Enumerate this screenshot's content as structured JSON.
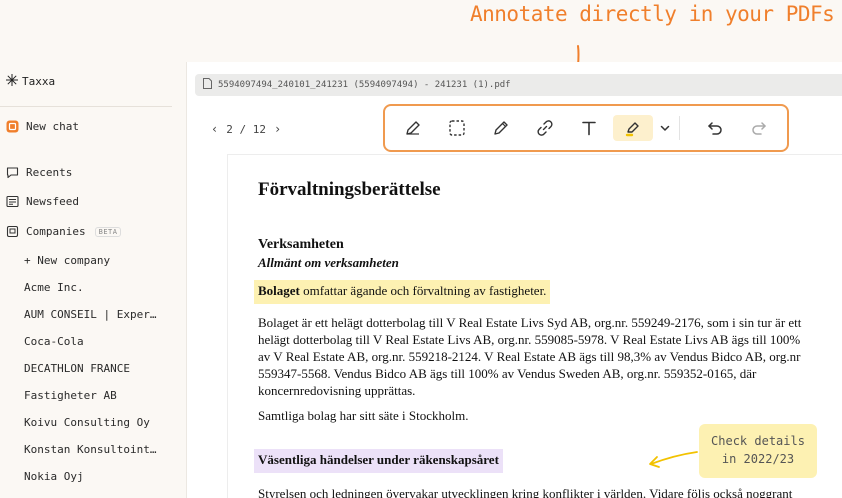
{
  "headline": "Annotate directly in your PDFs",
  "sidebar": {
    "brand": "Taxxa",
    "new_chat": "New chat",
    "recents": "Recents",
    "newsfeed": "Newsfeed",
    "companies": "Companies",
    "beta": "BETA",
    "new_company": "+ New company",
    "company_list": [
      "Acme Inc.",
      "AUM CONSEIL | Exper…",
      "Coca-Cola",
      "DECATHLON FRANCE",
      "Fastigheter AB",
      "Koivu Consulting Oy",
      "Konstan Konsultoint…",
      "Nokia Oyj"
    ]
  },
  "viewer": {
    "file_name": "5594097494_240101_241231 (5594097494) - 241231 (1).pdf",
    "page_indicator": "2 / 12"
  },
  "toolbar": {
    "tools": [
      "pen-icon",
      "select-area-icon",
      "pencil-icon",
      "link-icon",
      "text-icon",
      "highlighter-icon"
    ],
    "accent": "#f09a4f"
  },
  "document": {
    "title": "Förvaltningsberättelse",
    "section_heading": "Verksamheten",
    "subheading": "Allmänt om verksamheten",
    "highlight_bold": "Bolaget",
    "highlight_rest": " omfattar ägande och förvaltning av fastigheter.",
    "paragraph_lines": [
      "Bolaget är ett helägt dotterbolag till V Real Estate Livs Syd AB, org.nr. 559249-2176, som i sin tur är ett",
      "helägt dotterbolag till V Real Estate Livs AB, org.nr. 559085-5978. V Real Estate Livs AB ägs till 100%",
      "av V Real Estate AB, org.nr. 559218-2124. V Real Estate AB ägs till 98,3% av Vendus Bidco AB, org.nr",
      "559347-5568. Vendus Bidco AB ägs till 100% av Vendus Sweden AB, org.nr. 559352-0165, där",
      "koncernredovisning upprättas."
    ],
    "seat_text": "Samtliga bolag har sitt säte i Stockholm.",
    "purple_heading": "Väsentliga händelser under räkenskapsåret",
    "last_line": "Styrelsen och ledningen övervakar utvecklingen kring konflikter i världen. Vidare följs också noggrant"
  },
  "callout": {
    "line1": "Check details",
    "line2": "in 2022/23",
    "color": "#fdf1b2"
  }
}
